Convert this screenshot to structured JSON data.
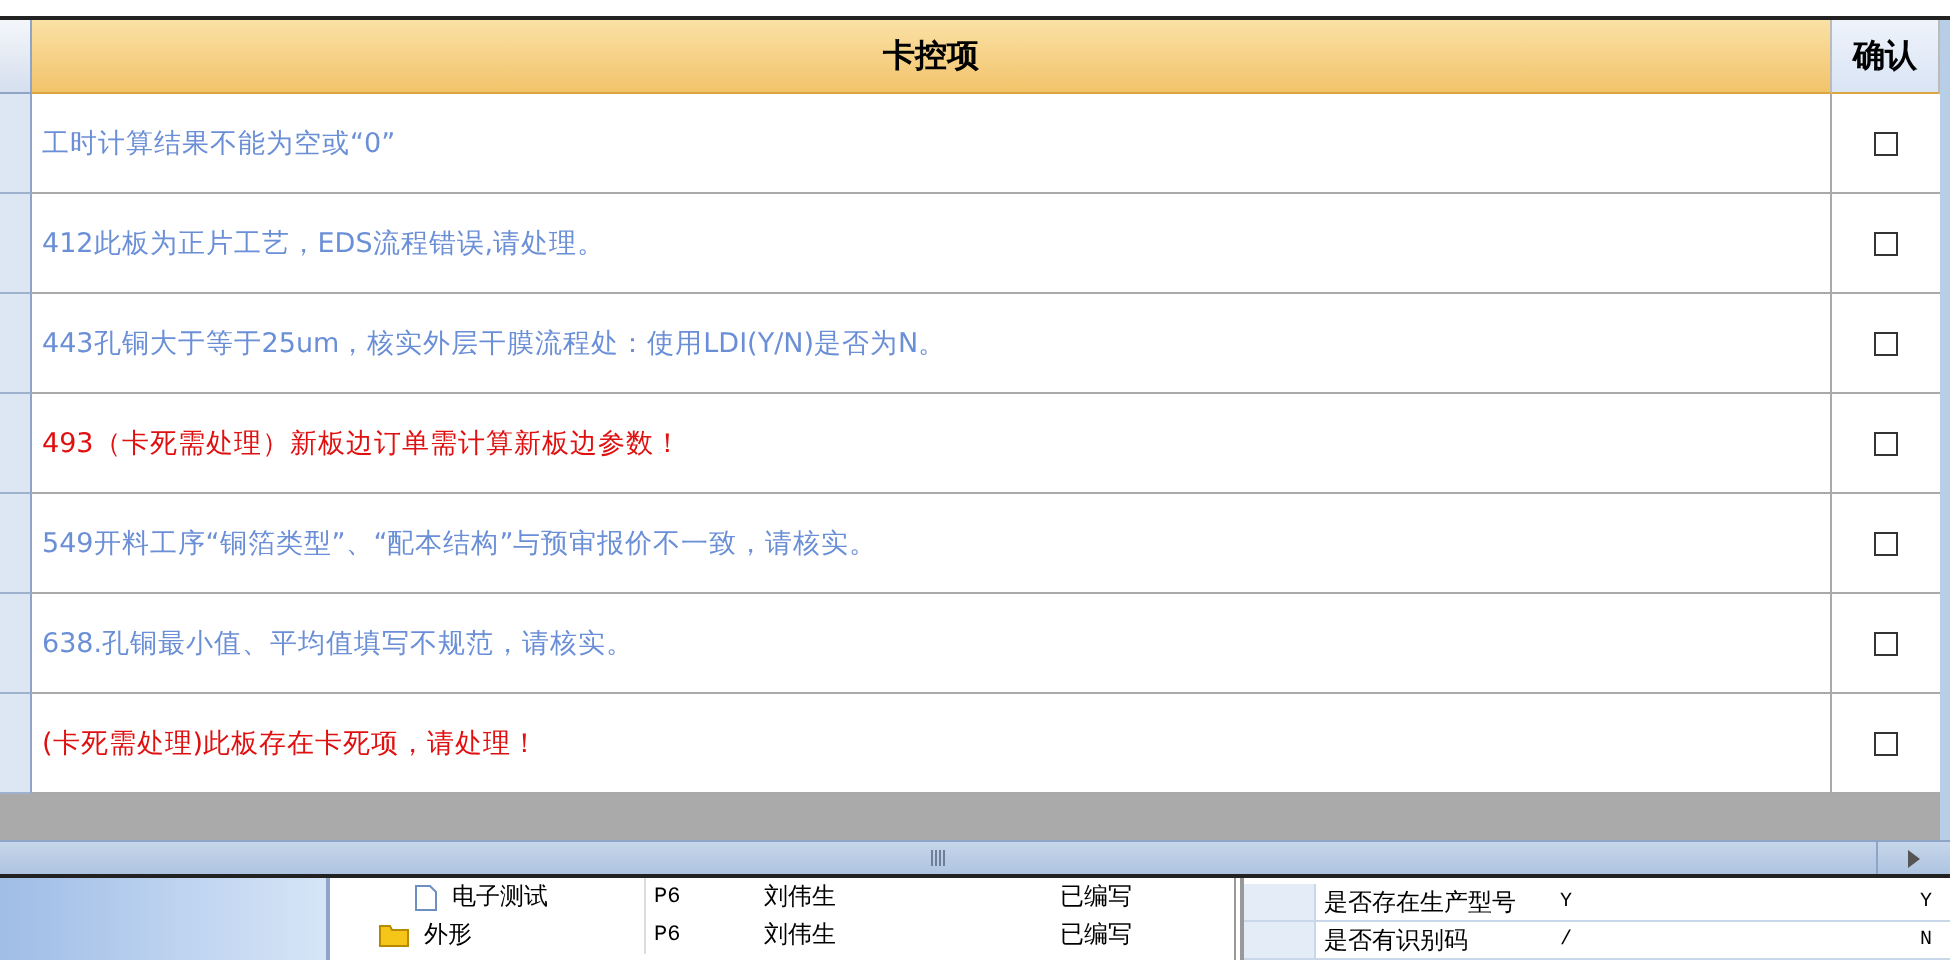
{
  "table": {
    "columns": [
      "卡控项",
      "确认"
    ],
    "rows": [
      {
        "text": "工时计算结果不能为空或“0”",
        "color": "#6b8fd6",
        "checked": false
      },
      {
        "text": "412此板为正片工艺，EDS流程错误,请处理。",
        "color": "#6b8fd6",
        "checked": false
      },
      {
        "text": "443孔铜大于等于25um，核实外层干膜流程处：使用LDI(Y/N)是否为N。",
        "color": "#6b8fd6",
        "checked": false
      },
      {
        "text": "493（卡死需处理）新板边订单需计算新板边参数！",
        "color": "#e01010",
        "checked": false
      },
      {
        "text": "549开料工序“铜箔类型”、“配本结构”与预审报价不一致，请核实。",
        "color": "#6b8fd6",
        "checked": false
      },
      {
        "text": "638.孔铜最小值、平均值填写不规范，请核实。",
        "color": "#6b8fd6",
        "checked": false
      },
      {
        "text": "(卡死需处理)此板存在卡死项，请处理！",
        "color": "#e01010",
        "checked": false
      }
    ]
  },
  "background": {
    "tree_rows": [
      {
        "name": "电子测试",
        "kind": "file",
        "code": "P6",
        "person": "刘伟生",
        "status": "已编写"
      },
      {
        "name": "外形",
        "kind": "folder",
        "code": "P6",
        "person": "刘伟生",
        "status": "已编写"
      }
    ],
    "properties": [
      {
        "label": "是否存在生产型号",
        "value": "Y",
        "flag": "Y"
      },
      {
        "label": "是否有识别码",
        "value": "/",
        "flag": "N"
      }
    ]
  }
}
